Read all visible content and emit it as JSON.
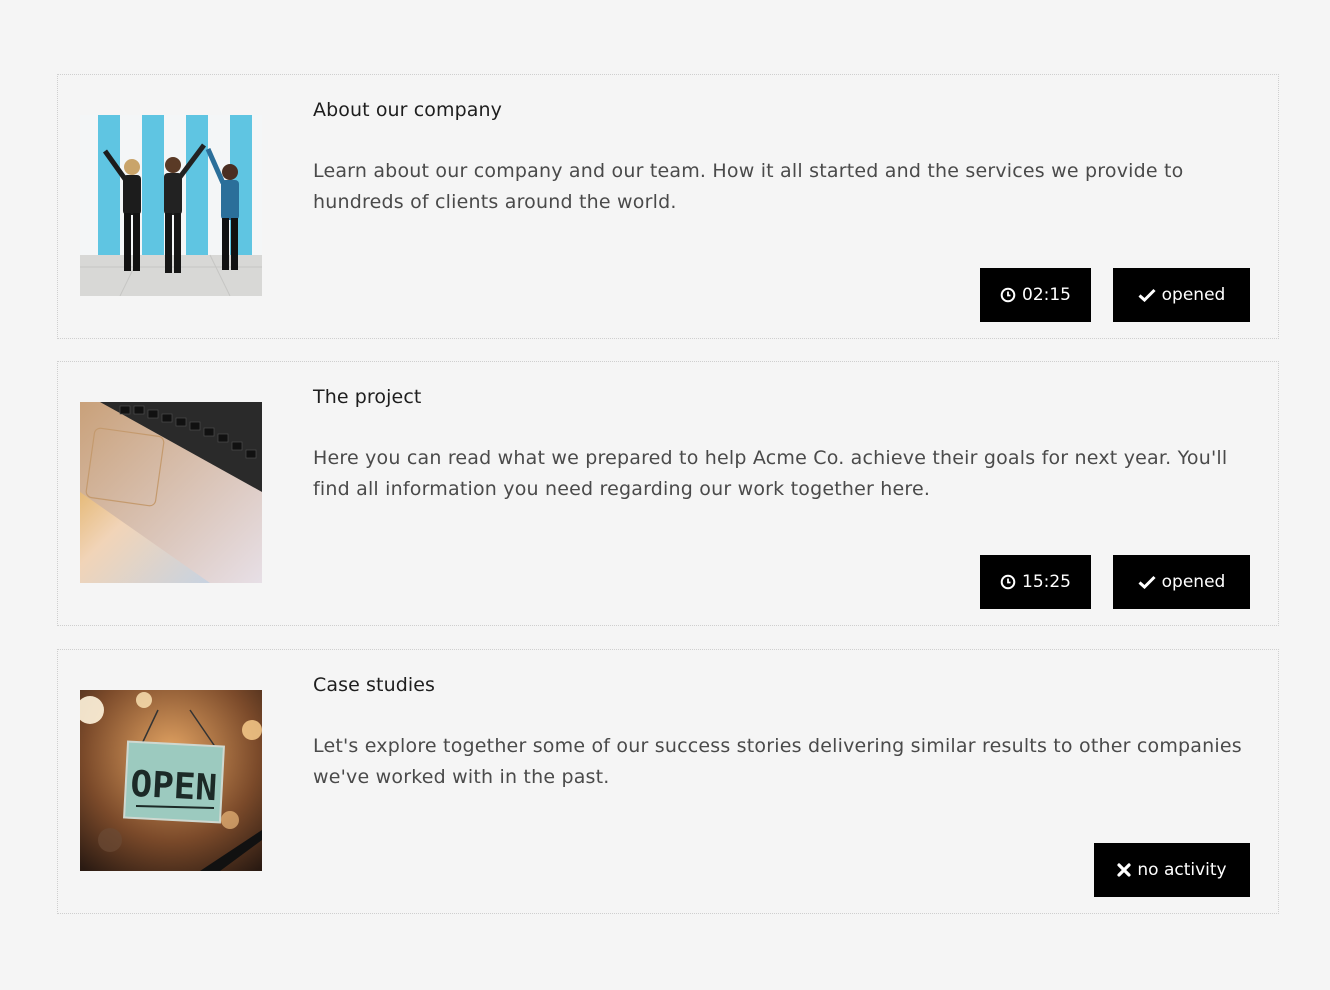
{
  "items": [
    {
      "title": "About our company",
      "description": "Learn about our company and our team. How it all started and the services we provide to hundreds of clients around the world.",
      "image": "people-walking-photo",
      "time": "02:15",
      "status": "opened",
      "time_icon": "clock-icon",
      "status_icon": "check-icon"
    },
    {
      "title": "The project",
      "description": "Here you can read what we prepared to help Acme Co. achieve their goals for next year. You'll find all information you need regarding our work together here.",
      "image": "laptop-keyboard-photo",
      "time": "15:25",
      "status": "opened",
      "time_icon": "clock-icon",
      "status_icon": "check-icon"
    },
    {
      "title": "Case studies",
      "description": "Let's explore together some of our success stories delivering similar results to other companies we've worked with in the past.",
      "image": "open-sign-photo",
      "status": "no activity",
      "status_icon": "x-icon"
    }
  ],
  "open_sign_text": "OPEN",
  "colors": {
    "background": "#f5f5f5",
    "button": "#000000",
    "button_text": "#ffffff",
    "title": "#1e1e1e",
    "description": "#4a4a4a"
  }
}
